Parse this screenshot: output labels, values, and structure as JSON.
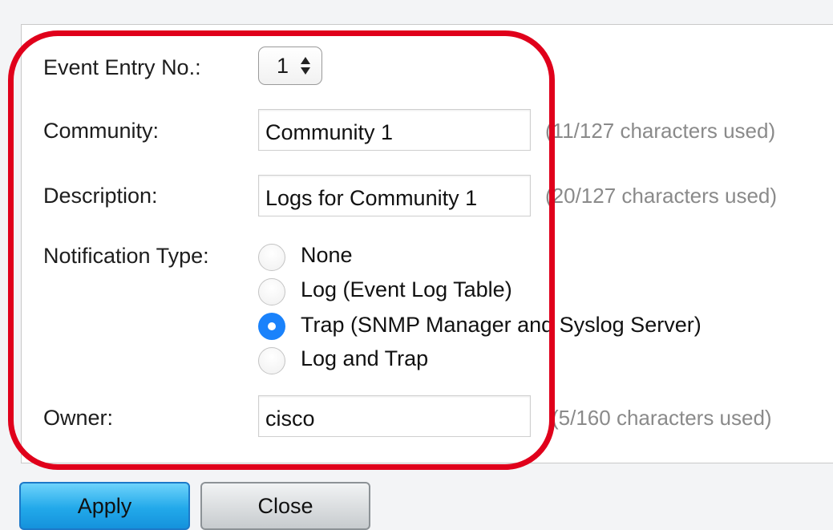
{
  "form": {
    "event_entry_label": "Event Entry No.:",
    "event_entry_value": "1",
    "community_label": "Community:",
    "community_value": "Community 1",
    "community_counter": "(11/127 characters used)",
    "description_label": "Description:",
    "description_value": "Logs for Community 1",
    "description_counter": "(20/127 characters used)",
    "notification_label": "Notification Type:",
    "notification_options": [
      {
        "label": "None",
        "checked": false
      },
      {
        "label": "Log (Event Log Table)",
        "checked": false
      },
      {
        "label": "Trap (SNMP Manager and Syslog Server)",
        "checked": true
      },
      {
        "label": "Log and Trap",
        "checked": false
      }
    ],
    "owner_label": "Owner:",
    "owner_value": "cisco",
    "owner_counter": "(5/160 characters used)"
  },
  "buttons": {
    "apply_label": "Apply",
    "close_label": "Close"
  },
  "colors": {
    "highlight": "#e0001b",
    "radio_checked": "#1a82fb",
    "apply_button": "#22a9ea",
    "close_button": "#c7cbce"
  }
}
